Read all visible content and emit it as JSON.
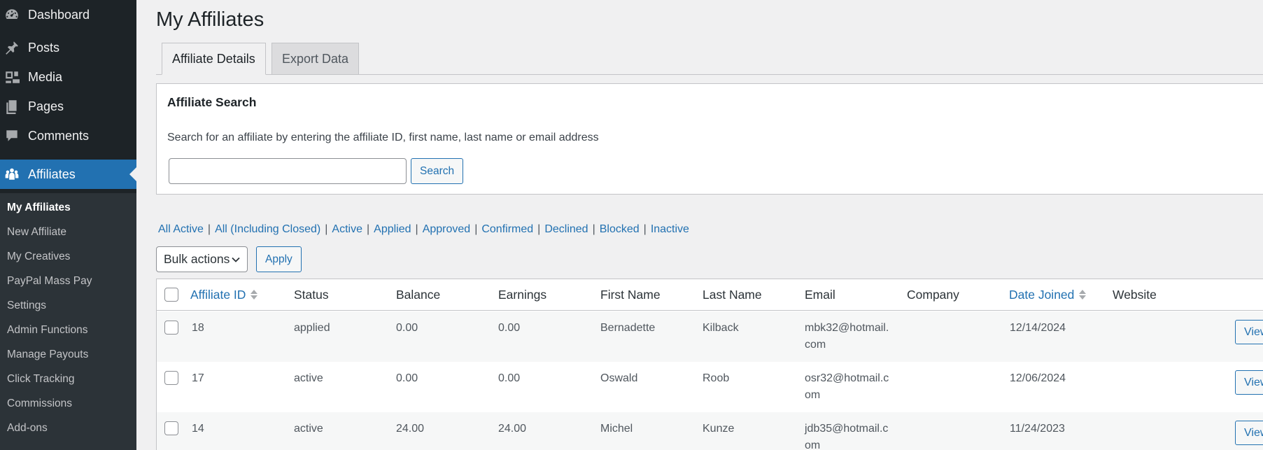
{
  "sidebar": {
    "menu": [
      {
        "label": "Dashboard",
        "icon": "dashboard-icon"
      },
      {
        "label": "Posts",
        "icon": "pin-icon"
      },
      {
        "label": "Media",
        "icon": "media-icon"
      },
      {
        "label": "Pages",
        "icon": "pages-icon"
      },
      {
        "label": "Comments",
        "icon": "comment-icon"
      },
      {
        "label": "Affiliates",
        "icon": "groups-icon"
      }
    ],
    "submenu": [
      "My Affiliates",
      "New Affiliate",
      "My Creatives",
      "PayPal Mass Pay",
      "Settings",
      "Admin Functions",
      "Manage Payouts",
      "Click Tracking",
      "Commissions",
      "Add-ons"
    ]
  },
  "page": {
    "title": "My Affiliates",
    "tabs": [
      "Affiliate Details",
      "Export Data"
    ]
  },
  "search": {
    "heading": "Affiliate Search",
    "description": "Search for an affiliate by entering the affiliate ID, first name, last name or email address",
    "value": "",
    "button": "Search"
  },
  "filters": [
    "All Active",
    "All (Including Closed)",
    "Active",
    "Applied",
    "Approved",
    "Confirmed",
    "Declined",
    "Blocked",
    "Inactive"
  ],
  "bulk": {
    "selected": "Bulk actions",
    "apply": "Apply"
  },
  "table": {
    "columns": [
      "Affiliate ID",
      "Status",
      "Balance",
      "Earnings",
      "First Name",
      "Last Name",
      "Email",
      "Company",
      "Date Joined",
      "Website"
    ],
    "rows": [
      {
        "id": "18",
        "status": "applied",
        "balance": "0.00",
        "earnings": "0.00",
        "first": "Bernadette",
        "last": "Kilback",
        "email": "mbk32@hotmail.com",
        "company": "",
        "joined": "12/14/2024",
        "website": "",
        "action": "View"
      },
      {
        "id": "17",
        "status": "active",
        "balance": "0.00",
        "earnings": "0.00",
        "first": "Oswald",
        "last": "Roob",
        "email": "osr32@hotmail.com",
        "company": "",
        "joined": "12/06/2024",
        "website": "",
        "action": "View"
      },
      {
        "id": "14",
        "status": "active",
        "balance": "24.00",
        "earnings": "24.00",
        "first": "Michel",
        "last": "Kunze",
        "email": "jdb35@hotmail.com",
        "company": "",
        "joined": "11/24/2023",
        "website": "",
        "action": "View"
      }
    ]
  },
  "colors": {
    "sidebar_bg": "#1d2327",
    "submenu_bg": "#2c3338",
    "accent": "#2271b1",
    "page_bg": "#f0f0f1"
  }
}
